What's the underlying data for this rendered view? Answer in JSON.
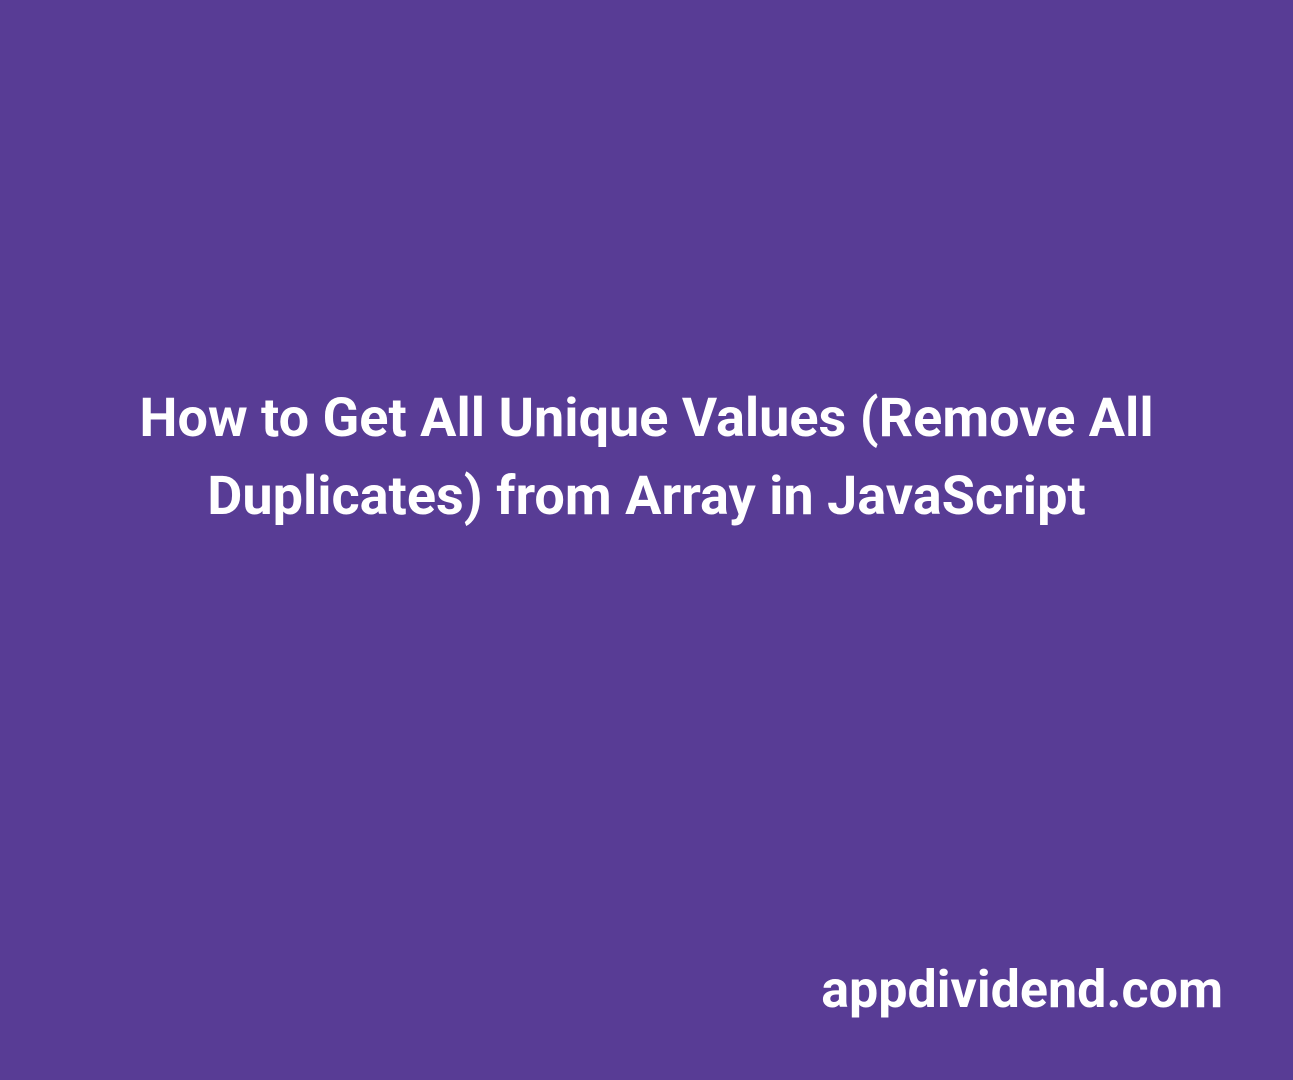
{
  "title": "How to Get All Unique Values (Remove All Duplicates) from Array in JavaScript",
  "site_name": "appdividend.com"
}
